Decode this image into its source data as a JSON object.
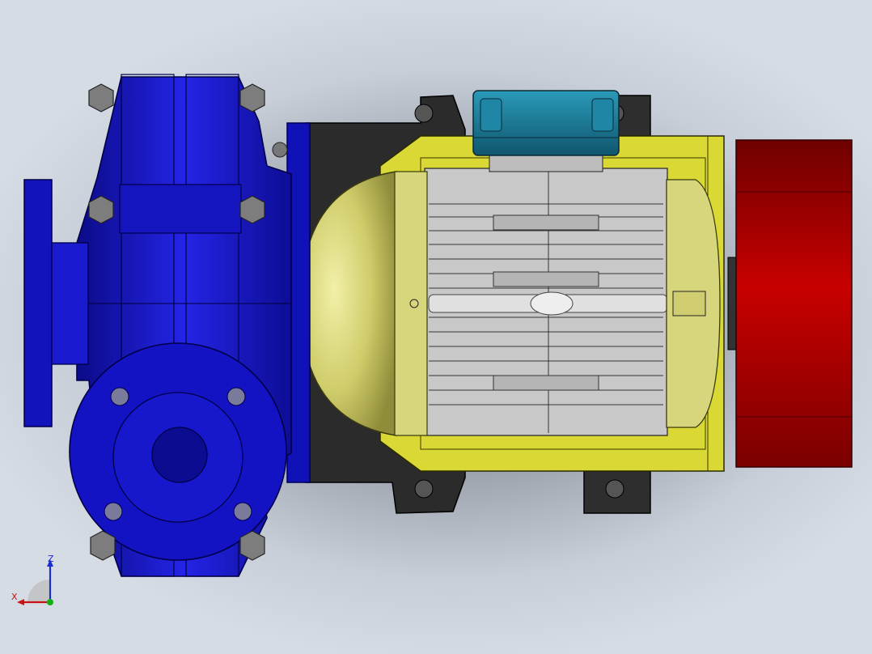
{
  "viewport": {
    "background_color": "#c9d0da",
    "shadow_color": "#6f737a"
  },
  "model": {
    "pump_color": "#1412c8",
    "pump_dark": "#0a0a7a",
    "motor_body_color": "#c8c8c8",
    "end_cap_color": "#d8d67c",
    "frame_color": "#d9d834",
    "fan_cover_color": "#b00000",
    "terminal_box_color": "#1a7896",
    "bracket_color": "#2a2a2a",
    "bolt_color": "#7a7a7a"
  },
  "triad": {
    "z_label": "Z",
    "x_label": "X",
    "z_color": "#1a2ecf",
    "x_color": "#c81414",
    "y_color": "#12b012"
  }
}
